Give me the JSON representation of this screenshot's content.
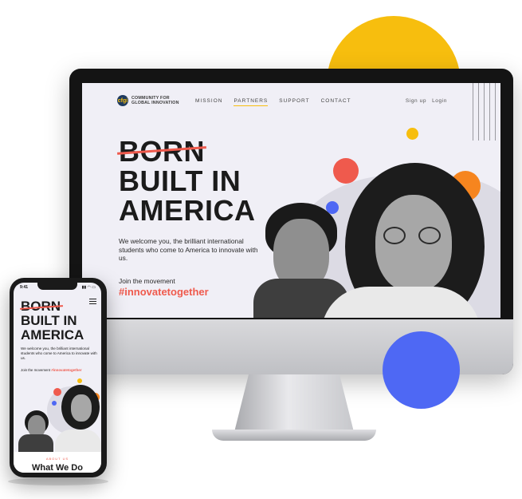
{
  "brand": {
    "logo_mark": "cfgi",
    "logo_line1": "COMMUNITY FOR",
    "logo_line2": "GLOBAL INNOVATION"
  },
  "nav": {
    "items": [
      {
        "label": "MISSION",
        "active": false
      },
      {
        "label": "PARTNERS",
        "active": true
      },
      {
        "label": "SUPPORT",
        "active": false
      },
      {
        "label": "CONTACT",
        "active": false
      }
    ],
    "signup": "Sign up",
    "login": "Login"
  },
  "hero": {
    "struck_word": "BORN",
    "line1": "BUILT IN",
    "line2": "AMERICA",
    "copy": "We welcome you, the brilliant international students who come to America to innovate with us.",
    "join": "Join the movement",
    "hashtag": "#innovatetogether"
  },
  "phone": {
    "time": "9:41",
    "status": "▮▮ ◠ ▭",
    "struck_word": "BORN",
    "line1": "BUILT IN",
    "line2": "AMERICA",
    "copy": "We welcome you, the brilliant international students who come to America to innovate with us.",
    "join": "Join the movement",
    "hashtag": "#innovatetogether",
    "section_label": "ABOUT US",
    "section_heading": "What We Do"
  },
  "colors": {
    "accent_red": "#ef5a4d",
    "accent_yellow": "#f7be0e",
    "accent_blue": "#4e68f4",
    "accent_orange": "#f6851f",
    "page_bg": "#f0eff6"
  },
  "icons": [
    "hamburger-menu-icon",
    "logo-icon"
  ]
}
